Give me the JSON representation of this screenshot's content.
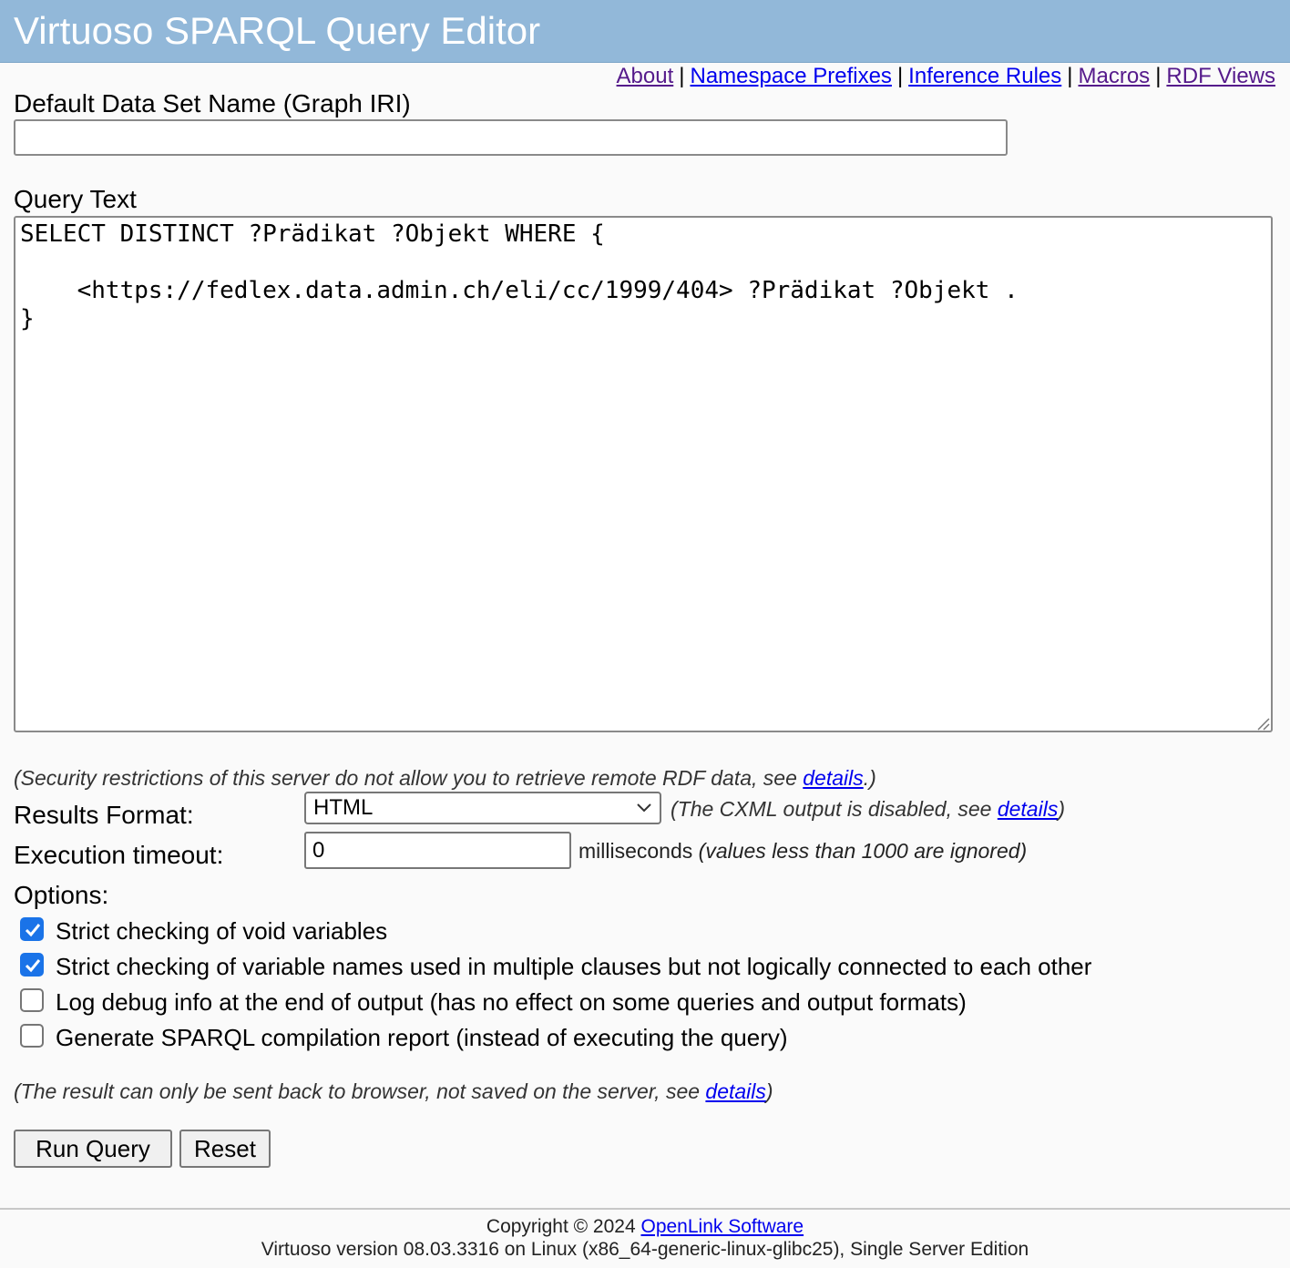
{
  "header": {
    "title": "Virtuoso SPARQL Query Editor"
  },
  "top_links": [
    {
      "label": "About"
    },
    {
      "label": "Namespace Prefixes"
    },
    {
      "label": "Inference Rules"
    },
    {
      "label": "Macros"
    },
    {
      "label": "RDF Views"
    }
  ],
  "graph": {
    "label": "Default Data Set Name (Graph IRI)",
    "value": ""
  },
  "query": {
    "label": "Query Text",
    "value": "SELECT DISTINCT ?Prädikat ?Objekt WHERE {\n\n    <https://fedlex.data.admin.ch/eli/cc/1999/404> ?Prädikat ?Objekt .\n}"
  },
  "security_note": {
    "prefix": "(Security restrictions of this server do not allow you to retrieve remote RDF data, see ",
    "link": "details",
    "suffix": ".)"
  },
  "results_format": {
    "label": "Results Format:",
    "selected": "HTML",
    "note_prefix": "(The CXML output is disabled, see ",
    "note_link": "details",
    "note_suffix": ")"
  },
  "timeout": {
    "label": "Execution timeout:",
    "value": "0",
    "unit": "milliseconds",
    "note": "(values less than 1000 are ignored)"
  },
  "options": {
    "label": "Options:",
    "items": [
      {
        "label": "Strict checking of void variables",
        "checked": true
      },
      {
        "label": "Strict checking of variable names used in multiple clauses but not logically connected to each other",
        "checked": true
      },
      {
        "label": "Log debug info at the end of output (has no effect on some queries and output formats)",
        "checked": false
      },
      {
        "label": "Generate SPARQL compilation report (instead of executing the query)",
        "checked": false
      }
    ]
  },
  "result_note": {
    "prefix": "(The result can only be sent back to browser, not saved on the server, see ",
    "link": "details",
    "suffix": ")"
  },
  "buttons": {
    "run": "Run Query",
    "reset": "Reset"
  },
  "footer": {
    "copyright": "Copyright © 2024",
    "company": "OpenLink Software",
    "version": "Virtuoso version 08.03.3316 on Linux (x86_64-generic-linux-glibc25), Single Server Edition"
  }
}
